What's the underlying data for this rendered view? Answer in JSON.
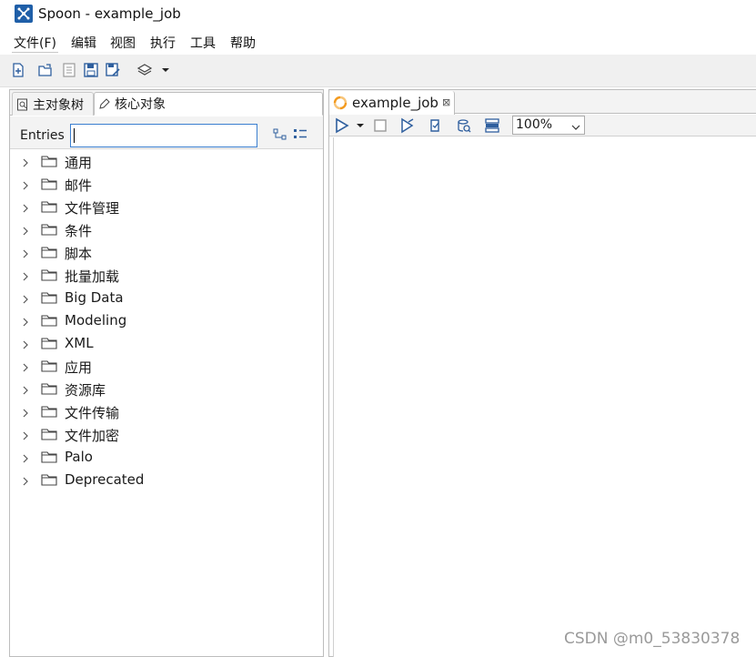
{
  "window": {
    "title": "Spoon - example_job"
  },
  "menu": {
    "items": [
      "文件(F)",
      "编辑",
      "视图",
      "执行",
      "工具",
      "帮助"
    ]
  },
  "toolbar": {
    "icons": [
      "new-file-icon",
      "open-folder-icon",
      "explore-repo-icon",
      "save-icon",
      "save-as-icon",
      "perspective-layers-icon",
      "dropdown-arrow-icon"
    ]
  },
  "left_panel": {
    "tabs": [
      {
        "label": "主对象树",
        "icon": "magnifier-page-icon"
      },
      {
        "label": "核心对象",
        "icon": "pencil-icon"
      }
    ],
    "search": {
      "label": "Entries",
      "value": ""
    },
    "tree_items": [
      "通用",
      "邮件",
      "文件管理",
      "条件",
      "脚本",
      "批量加载",
      "Big Data",
      "Modeling",
      "XML",
      "应用",
      "资源库",
      "文件传输",
      "文件加密",
      "Palo",
      "Deprecated"
    ]
  },
  "right_panel": {
    "tab": {
      "label": "example_job",
      "icon": "job-icon",
      "close": "⊠"
    },
    "zoom": "100%",
    "toolbar_icons": [
      "run-icon",
      "run-dropdown-icon",
      "stop-icon",
      "run-options-icon",
      "check-job-icon",
      "sql-icon",
      "analyze-icon"
    ]
  },
  "watermark": "CSDN @m0_53830378",
  "colors": {
    "accent": "#3b7fd0",
    "app_icon": "#1f5fa8",
    "job_icon": "#f39a1e"
  }
}
